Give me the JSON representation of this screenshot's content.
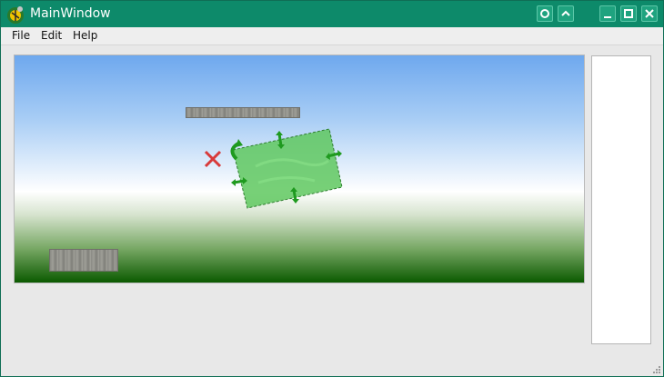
{
  "window": {
    "title": "MainWindow",
    "buttons": [
      "pin-icon",
      "shade-icon",
      "minimize-icon",
      "maximize-icon",
      "close-icon"
    ]
  },
  "menubar": {
    "items": [
      {
        "label": "File"
      },
      {
        "label": "Edit"
      },
      {
        "label": "Help"
      }
    ]
  },
  "scene": {
    "sky_colors": [
      "#6ea8ee",
      "#ffffff",
      "#0b5a00"
    ],
    "selection_color": "#5fc85f",
    "delete_marker_color": "#d83a3a",
    "icons": [
      "rotate-handle-icon",
      "resize-handle-icon",
      "delete-x-icon"
    ]
  }
}
